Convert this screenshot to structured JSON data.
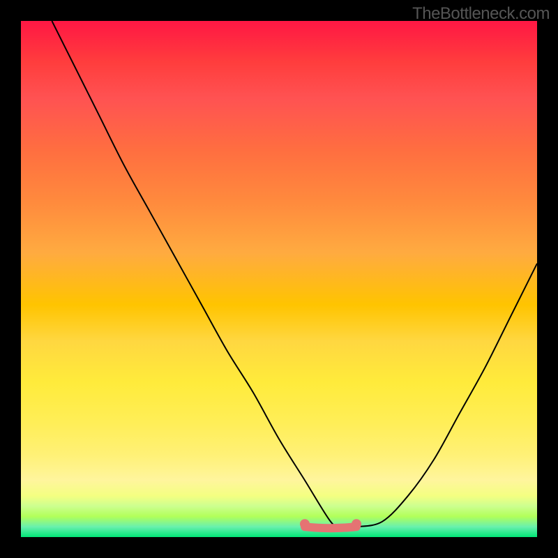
{
  "watermark": "TheBottleneck.com",
  "colors": {
    "gradient_top": "#ff1744",
    "gradient_mid": "#ffeb3b",
    "gradient_bottom": "#00e676",
    "curve": "#000000",
    "flat_emphasis": "#e57373",
    "frame": "#000000"
  },
  "chart_data": {
    "type": "line",
    "title": "",
    "xlabel": "",
    "ylabel": "",
    "xlim": [
      0,
      100
    ],
    "ylim": [
      0,
      100
    ],
    "grid": false,
    "legend": false,
    "series": [
      {
        "name": "curve",
        "x": [
          6,
          10,
          15,
          20,
          25,
          30,
          35,
          40,
          45,
          50,
          55,
          60,
          62,
          65,
          70,
          75,
          80,
          85,
          90,
          95,
          100
        ],
        "y": [
          100,
          92,
          82,
          72,
          63,
          54,
          45,
          36,
          28,
          19,
          11,
          3,
          2,
          2,
          3,
          8,
          15,
          24,
          33,
          43,
          53
        ]
      }
    ],
    "flat_region": {
      "x_start": 55,
      "x_end": 65,
      "y": 2
    }
  }
}
